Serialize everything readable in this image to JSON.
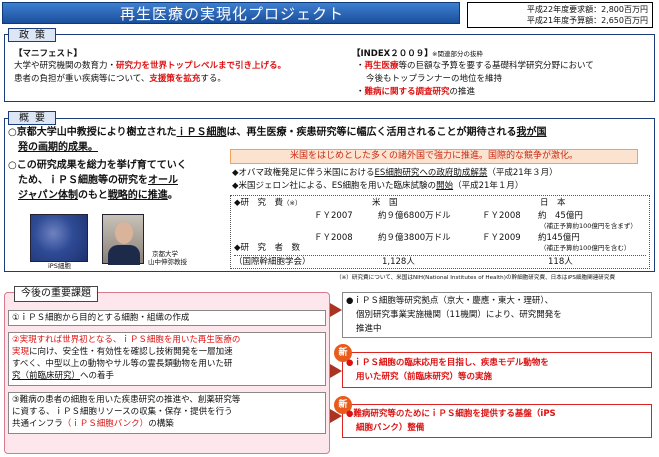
{
  "title": "再生医療の実現化プロジェクト",
  "budget": {
    "line1": "平成22年度要求額：2,800百万円",
    "line2": "平成21年度予算額：2,650百万円"
  },
  "policy": {
    "label": "政策",
    "manifesto_title": "【マニフェスト】",
    "manifesto_l1_a": "大学や研究機関の数育力・",
    "manifesto_l1_b": "研究力を世界トップレベルまで引き上げる。",
    "manifesto_l2_a": "患者の負担が重い疾病等について、",
    "manifesto_l2_b": "支援策を拡充",
    "manifesto_l2_c": "する。",
    "index_title": "【INDEX２００９】",
    "index_note": "※関連部分の抜粋",
    "index_l1_a": "・",
    "index_l1_b": "再生医療",
    "index_l1_c": "等の巨額な予算を要する基礎科学研究分野において",
    "index_l2": "今後もトップランナーの地位を維持",
    "index_l3_a": "・",
    "index_l3_b": "難病に関する調査研究",
    "index_l3_c": "の推進"
  },
  "overview": {
    "label": "概要",
    "p1_a": "○京都大学山中教授により樹立された",
    "p1_b": "ｉＰＳ細胞",
    "p1_c": "は、再生医療・疾患研究等に幅広く活用されることが期待される",
    "p1_d": "我が国",
    "p1_e": "発の画期的成果。",
    "p2_l1": "○この研究成果を総力を挙げ育てていく",
    "p2_l2_a": "ため、ｉＰＳ細胞等の研究を",
    "p2_l2_b": "オール",
    "p2_l3_a": "ジャパン体制",
    "p2_l3_b": "のもと",
    "p2_l3_c": "戦略的に推進",
    "p2_l3_d": "。",
    "banner": "米国をはじめとした多くの諸外国で強力に推進。国際的な競争が激化。",
    "us_l1_a": "◆オバマ政権発足に伴う米国における",
    "us_l1_b": "ES細胞研究への政府助成解禁",
    "us_l1_c": "（平成21年３月）",
    "us_l2_a": "◆米国ジェロン社による、ES細胞を用いた臨床試験の",
    "us_l2_b": "開始",
    "us_l2_c": "（平成21年１月）",
    "table": {
      "row_funding": "◆研　究　費",
      "footnote_mark": "（※）",
      "col_us": "米　国",
      "col_jp": "日　本",
      "us_fy2007_label": "ＦＹ2007",
      "us_fy2007_value": "約９億6800万ドル",
      "us_fy2008_label": "ＦＹ2008",
      "us_fy2008_value": "約９億3800万ドル",
      "jp_fy2008_label": "ＦＹ2008",
      "jp_fy2008_value": "約　45億円",
      "jp_fy2008_note": "（補正予算約100億円を含まず）",
      "jp_fy2009_label": "ＦＹ2009",
      "jp_fy2009_value": "約145億円",
      "jp_fy2009_note": "（補正予算約100億円を含む）",
      "row_researchers": "◆研　究　者　数",
      "researchers_sub": "（国際幹細胞学会）",
      "us_researchers": "1,128人",
      "jp_researchers": "118人"
    },
    "photo1_caption": "iPS細胞",
    "photo2_caption_l1": "京都大学",
    "photo2_caption_l2": "山中伸弥教授"
  },
  "footnote": "（※）研究費について、米国はNIH(National Institutes of Health)の幹細胞研究費、日本はiPS細胞関連研究費",
  "issues": {
    "label": "今後の重要課題",
    "i1": "①ｉＰＳ細胞から目的とする細胞・組織の作成",
    "i2_l1": "②実現すれば世界初となる、ｉＰＳ細胞を用いた再生医療の",
    "i2_l2_a": "実現",
    "i2_l2_b": "に向け、安全性・有効性を確認し技術開発を一層加速",
    "i2_l3": "すべく、中型以上の動物やサル等の霊長類動物を用いた研",
    "i2_l4_a": "究（前臨床研究）",
    "i2_l4_b": "への着手",
    "i3_l1": "③難病の患者の細胞を用いた疾患研究の推進や、創薬研究等",
    "i3_l2": "に資する、ｉＰＳ細胞リソースの収集・保存・提供を行う",
    "i3_l3_a": "共通インフラ",
    "i3_l3_b": "（ｉＰＳ細胞バンク）",
    "i3_l3_c": "の構築"
  },
  "actions": {
    "a1_l1": "●ｉＰＳ細胞等研究拠点（京大・慶應・東大・理研）、",
    "a1_l2": "個別研究事業実施機関（11機関）により、研究開発を",
    "a1_l3": "推進中",
    "new_badge": "新",
    "a2_l1": "●ｉＰＳ細胞の臨床応用を目指し、疾患モデル動物を",
    "a2_l2": "用いた研究（前臨床研究）等の実施",
    "a3_l1": "●難病研究等のためにｉＰＳ細胞を提供する基盤（iPS",
    "a3_l2": "細胞バンク）整備"
  }
}
